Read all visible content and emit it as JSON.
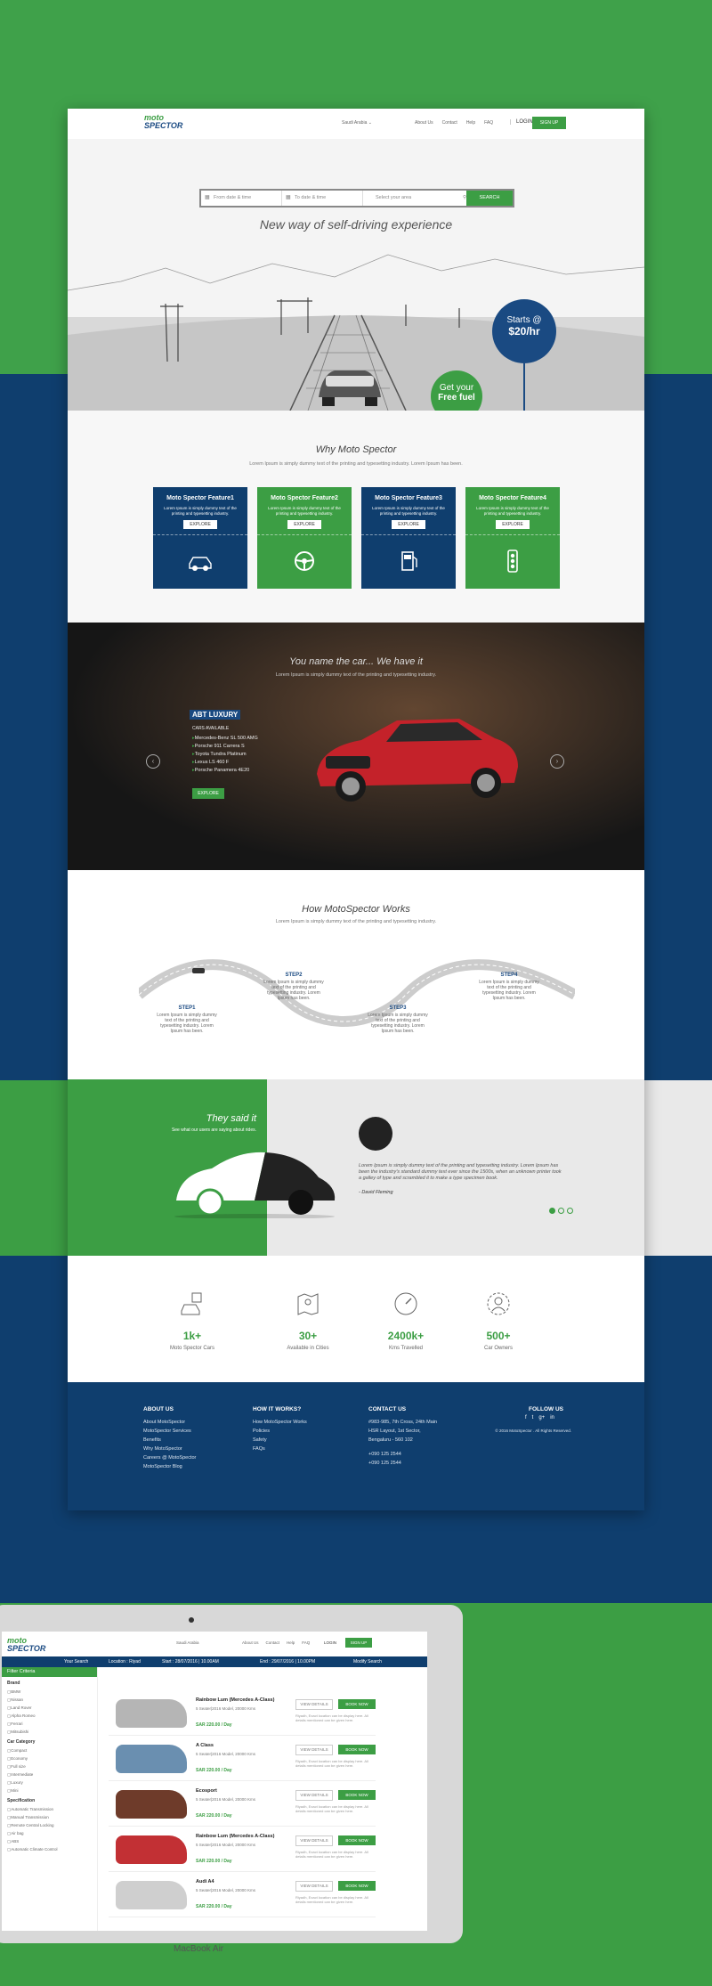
{
  "brand": {
    "logo_line1": "moto",
    "logo_line2": "SPECTOR"
  },
  "nav": {
    "country": "Saudi Arabia",
    "links": [
      "About Us",
      "Contact",
      "Help",
      "FAQ"
    ],
    "login": "LOGIN",
    "signup": "SIGN UP"
  },
  "search": {
    "from_placeholder": "From date & time",
    "to_placeholder": "To date & time",
    "area_placeholder": "Select your area",
    "button": "SEARCH"
  },
  "hero": {
    "title": "New way of self-driving experience",
    "starts_line1": "Starts @",
    "starts_line2": "$20/hr",
    "fuel_line1": "Get your",
    "fuel_line2": "Free fuel"
  },
  "why": {
    "title": "Why Moto Spector",
    "subtitle": "Lorem Ipsum is simply dummy text of the printing and typesetting industry. Lorem Ipsum has been.",
    "features": [
      {
        "title": "Moto Spector Feature1",
        "desc": "Lorem Ipsum is simply dummy text of the printing and typesetting industry.",
        "button": "EXPLORE",
        "icon": "car-icon"
      },
      {
        "title": "Moto Spector Feature2",
        "desc": "Lorem Ipsum is simply dummy text of the printing and typesetting industry.",
        "button": "EXPLORE",
        "icon": "steering-wheel-icon"
      },
      {
        "title": "Moto Spector Feature3",
        "desc": "Lorem Ipsum is simply dummy text of the printing and typesetting industry.",
        "button": "EXPLORE",
        "icon": "fuel-pump-icon"
      },
      {
        "title": "Moto Spector Feature4",
        "desc": "Lorem Ipsum is simply dummy text of the printing and typesetting industry.",
        "button": "EXPLORE",
        "icon": "traffic-light-icon"
      }
    ]
  },
  "showcase": {
    "title": "You name the car... We have it",
    "subtitle": "Lorem Ipsum is simply dummy text of the printing and typesetting industry.",
    "badge": "ABT LUXURY",
    "available_label": "CARS AVAILABLE",
    "cars": [
      "Mercedes-Benz SL 500 AMG",
      "Porsche 911 Carrera S",
      "Toyota Tundra Platinum",
      "Lexus LS 460 F",
      "Porsche Panamera 4E20"
    ],
    "button": "EXPLORE"
  },
  "how": {
    "title": "How MotoSpector Works",
    "subtitle": "Lorem Ipsum is simply dummy text of the printing and typesetting industry.",
    "steps": [
      {
        "label": "STEP1",
        "text": "Lorem Ipsum is simply dummy text of the printing and typesetting industry. Lorem Ipsum has been."
      },
      {
        "label": "STEP2",
        "text": "Lorem Ipsum is simply dummy text of the printing and typesetting industry. Lorem Ipsum has been."
      },
      {
        "label": "STEP3",
        "text": "Lorem Ipsum is simply dummy text of the printing and typesetting industry. Lorem Ipsum has been."
      },
      {
        "label": "STEP4",
        "text": "Lorem Ipsum is simply dummy text of the printing and typesetting industry. Lorem Ipsum has been."
      }
    ]
  },
  "testimonial": {
    "title": "They said it",
    "subtitle": "See what our users are saying about rides.",
    "quote": "Lorem Ipsum is simply dummy text of the printing and typesetting industry. Lorem Ipsum has been the industry's standard dummy text ever since the 1500s, when an unknown printer took a galley of type and scrambled it to make a type specimen book.",
    "author": "- David Fleming",
    "active_slide": 1
  },
  "stats": [
    {
      "value": "1k+",
      "label": "Moto Spector Cars",
      "icon": "parking-car-icon"
    },
    {
      "value": "30+",
      "label": "Available in Cities",
      "icon": "map-icon"
    },
    {
      "value": "2400k+",
      "label": "Kms Travelled",
      "icon": "speedometer-icon"
    },
    {
      "value": "500+",
      "label": "Car Owners",
      "icon": "owner-icon"
    }
  ],
  "footer": {
    "about_title": "ABOUT US",
    "about_links": [
      "About MotoSpector",
      "MotoSpector Services",
      "Benefits",
      "Why MotoSpector",
      "Careers @ MotoSpector",
      "MotoSpector Blog"
    ],
    "how_title": "HOW IT WORKS?",
    "how_links": [
      "How MotoSpector Works",
      "Policies",
      "Safety",
      "FAQs"
    ],
    "contact_title": "CONTACT US",
    "address": [
      "#983-985, 7th Cross, 24th Main",
      "HSR Layout, 1st Sector,",
      "Bengaluru - 560 102"
    ],
    "phones": [
      "+090 125 2544",
      "+090 125 2544"
    ],
    "follow_title": "FOLLOW US",
    "copyright": "© 2016 MotoSpector . All Rights Reserved."
  },
  "laptop": {
    "device_label": "MacBook Air",
    "bar_your_search": "Your Search",
    "bar_location": "Location : Riyad",
    "bar_start": "Start : 28/07/2016 | 10.00AM",
    "bar_end": "End : 29/07/2016 | 10.00PM",
    "bar_modify": "Modify Search",
    "filter_title": "Filter Criteria",
    "filter_sections": [
      {
        "title": "Brand",
        "items": [
          "BMW",
          "Nissan",
          "Land Rover",
          "Alpha Romeo",
          "Ferrari",
          "Mitsubishi"
        ]
      },
      {
        "title": "Car Category",
        "items": [
          "Compact",
          "Economy",
          "Full size",
          "Intermediate",
          "Luxury",
          "Mini"
        ]
      },
      {
        "title": "Specification",
        "items": [
          "Automatic Transmission",
          "Manual Transmission",
          "Remote Central Locking",
          "Air bag",
          "ABS",
          "Automatic Climate Control"
        ]
      }
    ],
    "results": [
      {
        "name": "Rainbow Lum (Mercedes A-Class)",
        "info": "5 Seater|2016 Model, 20000 Kms",
        "price": "SAR 220.00 / Day",
        "color": "#b5b5b5"
      },
      {
        "name": "A Class",
        "info": "5 Seater|2016 Model, 20000 Kms",
        "price": "SAR 220.00 / Day",
        "color": "#6a8fb0"
      },
      {
        "name": "Ecosport",
        "info": "5 Seater|2016 Model, 20000 Kms",
        "price": "SAR 220.00 / Day",
        "color": "#6e3b2a"
      },
      {
        "name": "Rainbow Lum (Mercedes A-Class)",
        "info": "5 Seater|2016 Model, 20000 Kms",
        "price": "SAR 220.00 / Day",
        "color": "#c23034"
      },
      {
        "name": "Audi A4",
        "info": "5 Seater|2016 Model, 20000 Kms",
        "price": "SAR 220.00 / Day",
        "color": "#cfcfcf"
      }
    ],
    "view_details": "VIEW DETAILS",
    "book_now": "BOOK NOW",
    "note": "Riyadh, Exact location can be display here. All details mentioned can be given here."
  }
}
